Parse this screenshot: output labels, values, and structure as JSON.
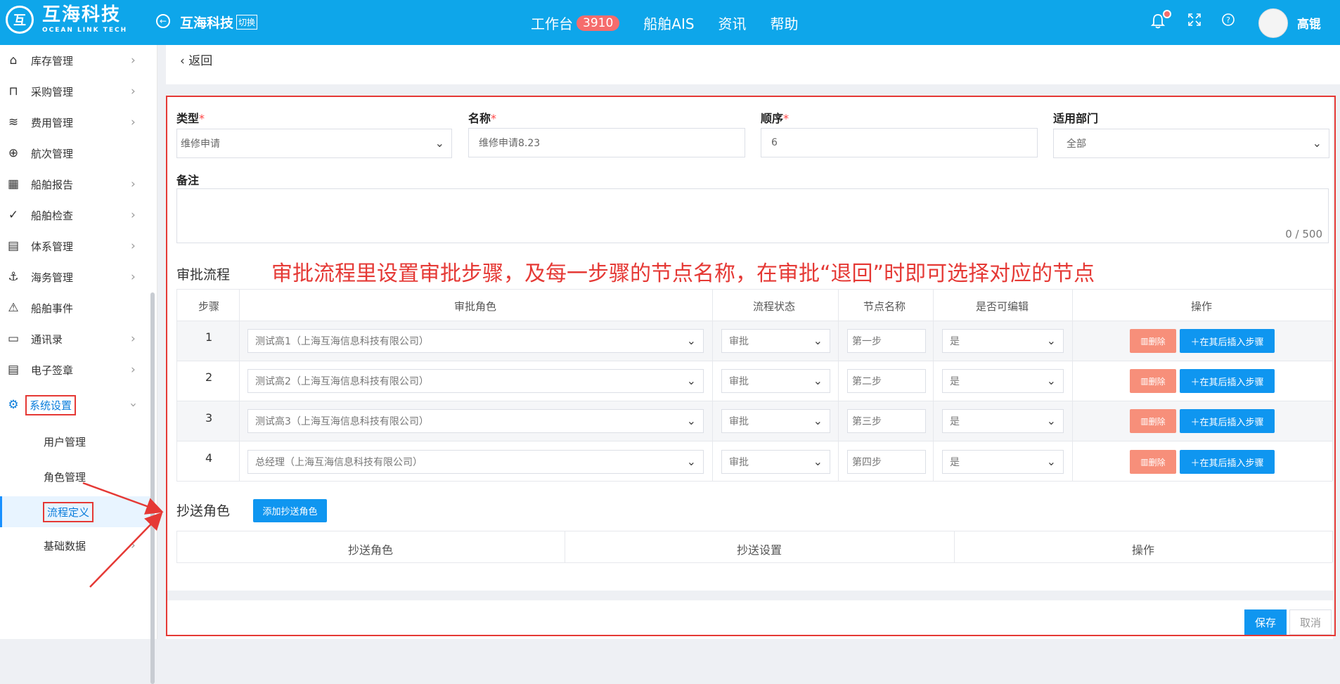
{
  "brand": {
    "name": "互海科技",
    "name_en": "OCEAN LINK TECH"
  },
  "header": {
    "company": "互海科技",
    "switch": "切换",
    "nav": [
      {
        "label": "工作台",
        "badge": "3910"
      },
      {
        "label": "船舶AIS"
      },
      {
        "label": "资讯"
      },
      {
        "label": "帮助"
      }
    ],
    "user": "高锟"
  },
  "sidebar": {
    "items": [
      {
        "label": "库存管理",
        "icon": "home-icon"
      },
      {
        "label": "采购管理",
        "icon": "cart-icon"
      },
      {
        "label": "费用管理",
        "icon": "database-icon"
      },
      {
        "label": "航次管理",
        "icon": "globe-icon"
      },
      {
        "label": "船舶报告",
        "icon": "calendar-icon"
      },
      {
        "label": "船舶检查",
        "icon": "check-circle-icon"
      },
      {
        "label": "体系管理",
        "icon": "document-icon"
      },
      {
        "label": "海务管理",
        "icon": "anchor-icon"
      },
      {
        "label": "船舶事件",
        "icon": "warning-icon"
      },
      {
        "label": "通讯录",
        "icon": "contacts-icon"
      },
      {
        "label": "电子签章",
        "icon": "stamp-icon"
      },
      {
        "label": "系统设置",
        "icon": "gear-icon"
      }
    ],
    "sub_items": [
      {
        "label": "用户管理"
      },
      {
        "label": "角色管理"
      },
      {
        "label": "流程定义"
      },
      {
        "label": "基础数据"
      }
    ]
  },
  "back": "返回",
  "form": {
    "type": {
      "label": "类型",
      "value": "维修申请"
    },
    "name": {
      "label": "名称",
      "value": "维修申请8.23"
    },
    "order": {
      "label": "顺序",
      "value": "6"
    },
    "dept": {
      "label": "适用部门",
      "value": "全部"
    },
    "remark": {
      "label": "备注",
      "counter": "0 / 500"
    },
    "required_mark": "*"
  },
  "annotation": "审批流程里设置审批步骤，及每一步骤的节点名称，在审批“退回”时即可选择对应的节点",
  "approval": {
    "title": "审批流程",
    "columns": [
      "步骤",
      "审批角色",
      "流程状态",
      "节点名称",
      "是否可编辑",
      "操作"
    ],
    "rows": [
      {
        "step": "1",
        "role": "测试高1（上海互海信息科技有限公司）",
        "status": "审批",
        "node": "第一步",
        "editable": "是"
      },
      {
        "step": "2",
        "role": "测试高2（上海互海信息科技有限公司）",
        "status": "审批",
        "node": "第二步",
        "editable": "是"
      },
      {
        "step": "3",
        "role": "测试高3（上海互海信息科技有限公司）",
        "status": "审批",
        "node": "第三步",
        "editable": "是"
      },
      {
        "step": "4",
        "role": "总经理（上海互海信息科技有限公司）",
        "status": "审批",
        "node": "第四步",
        "editable": "是"
      }
    ],
    "delete_label": "删除",
    "insert_label": "在其后插入步骤"
  },
  "cc": {
    "title": "抄送角色",
    "add_button": "添加抄送角色",
    "columns": [
      "抄送角色",
      "抄送设置",
      "操作"
    ]
  },
  "footer": {
    "save": "保存",
    "cancel": "取消"
  },
  "colors": {
    "primary": "#0ea6ea",
    "danger": "#e53935",
    "delete": "#f78f7a",
    "button": "#0f96f0"
  }
}
